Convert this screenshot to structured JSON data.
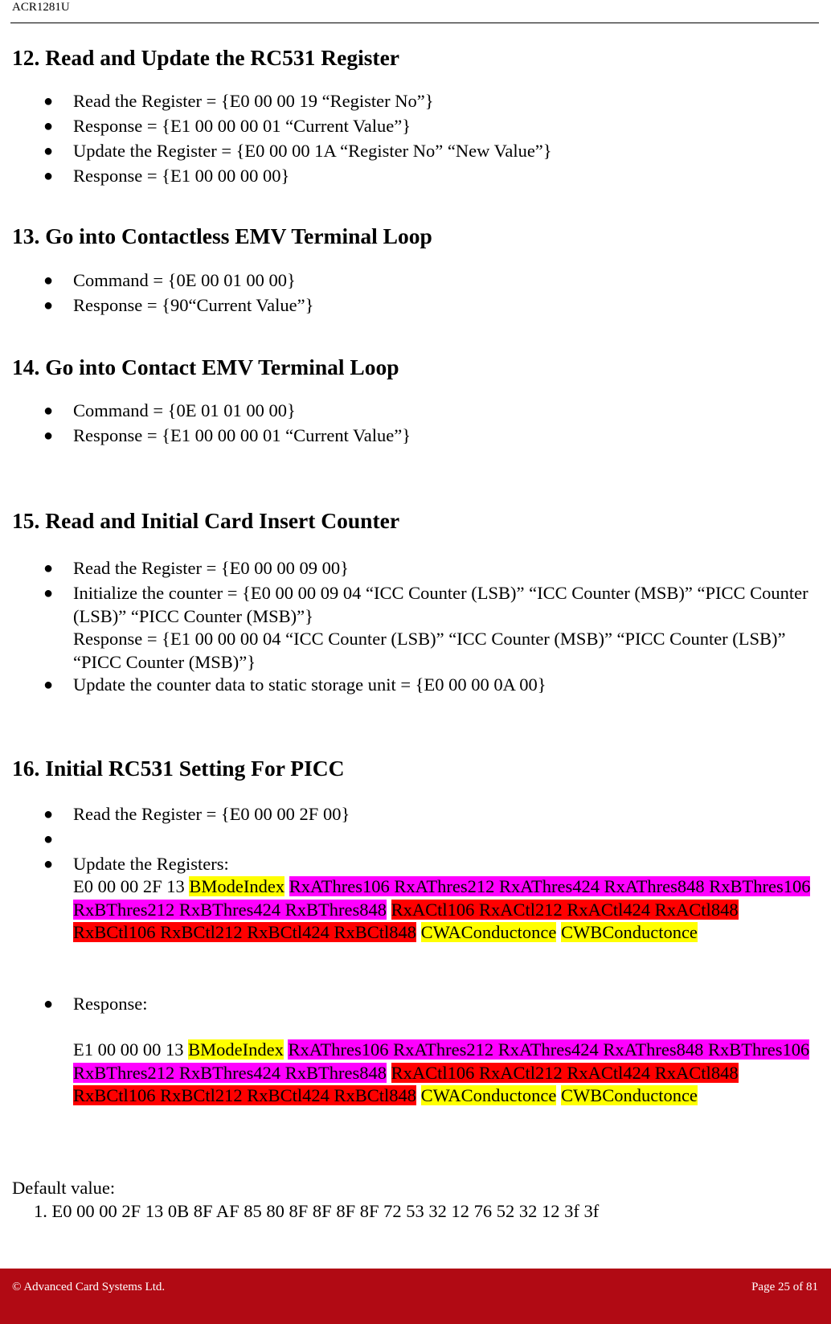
{
  "header": {
    "doc_title": "ACR1281U"
  },
  "sections": [
    {
      "heading": "12.  Read and Update the RC531 Register",
      "items": [
        "Read the Register = {E0 00 00 19 “Register No”}",
        "Response = {E1 00 00 00 01 “Current Value”}",
        "Update the Register = {E0 00 00 1A “Register No” “New Value”}",
        "Response = {E1 00 00 00 00}"
      ]
    },
    {
      "heading": "13. Go into Contactless EMV Terminal Loop",
      "items": [
        "Command = {0E 00 01 00 00}",
        "Response = {90“Current Value”}"
      ]
    },
    {
      "heading": "14. Go into Contact EMV Terminal Loop",
      "items": [
        "Command = {0E 01 01 00 00}",
        "Response = {E1 00 00 00 01 “Current Value”}"
      ]
    },
    {
      "heading": "15.  Read and Initial Card Insert Counter",
      "items": [
        "Read the Register = {E0 00 00 09 00}",
        "Initialize the counter = {E0 00 00 09 04 “ICC Counter (LSB)” “ICC Counter (MSB)” “PICC Counter (LSB)” “PICC Counter (MSB)”}",
        "Response = {E1 00 00 00 04 “ICC Counter (LSB)” “ICC Counter (MSB)” “PICC Counter (LSB)” “PICC Counter (MSB)”}",
        "Update the counter data to static storage unit = {E0 00 00 0A 00}"
      ]
    },
    {
      "heading": "16.  Initial RC531 Setting For PICC",
      "items": [
        "Read the Register = {E0 00 00 2F 00}",
        "",
        "Update the Registers:",
        "Response:"
      ],
      "update_prefix": "E0 00 00 2F 13",
      "response_prefix": "E1 00 00 00 13",
      "fields": {
        "bmode": "BModeIndex",
        "thres": "RxAThres106 RxAThres212 RxAThres424 RxAThres848",
        "thres_b": "RxBThres106 RxBThres212 RxBThres424 RxBThres848",
        "ctl_a": "RxACtl106 RxACtl212",
        "ctl_rest": "RxACtl424 RxACtl848 RxBCtl106 RxBCtl212 RxBCtl424 RxBCtl848",
        "cwa": "CWAConductonce",
        "cwb": "CWBConductonce"
      },
      "highlight_colors": {
        "yellow": "#ffff00",
        "magenta": "#ff00ff",
        "red": "#ff0000"
      }
    }
  ],
  "default_value": {
    "label": "Default value:",
    "entries": [
      "1. E0 00 00 2F 13 0B 8F AF 85 80 8F 8F 8F 8F 72 53 32 12 76 52 32 12 3f 3f"
    ]
  },
  "footer": {
    "copyright": "© Advanced Card Systems Ltd.",
    "page": "Page 25 of 81",
    "bar_color": "#b10a14"
  }
}
